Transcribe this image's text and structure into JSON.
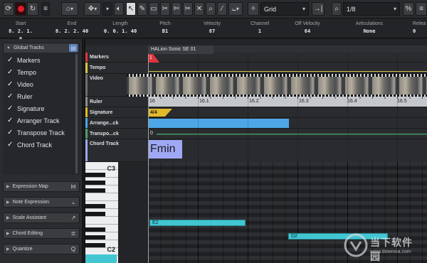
{
  "toolbar": {
    "grid_label": "Grid",
    "quantize_value": "1/8"
  },
  "info_line": [
    {
      "label": "Start",
      "value": "8. 2. 1.   0"
    },
    {
      "label": "End",
      "value": "8. 2. 2. 40"
    },
    {
      "label": "Length",
      "value": "0. 0. 1. 40"
    },
    {
      "label": "Pitch",
      "value": "B1"
    },
    {
      "label": "Velocity",
      "value": "87"
    },
    {
      "label": "Channel",
      "value": "1"
    },
    {
      "label": "Off Velocity",
      "value": "64"
    },
    {
      "label": "Articulations",
      "value": "None"
    },
    {
      "label": "Relea",
      "value": "0"
    }
  ],
  "inspector": {
    "global_tracks": {
      "title": "Global Tracks",
      "items": [
        "Markers",
        "Tempo",
        "Video",
        "Ruler",
        "Signature",
        "Arranger Track",
        "Transpose Track",
        "Chord Track"
      ]
    },
    "sections": [
      "Expression Map",
      "Note Expression",
      "Scale Assistant",
      "Chord Editing",
      "Quantize"
    ]
  },
  "editor": {
    "instrument_title": "HALion Sonic SE 01",
    "tracks": [
      "Markers",
      "Tempo",
      "Video",
      "Ruler",
      "Signature",
      "Arrange...ck",
      "Transpo...ck",
      "Chord Track"
    ],
    "marker_number": "1",
    "ruler_labels": [
      "16",
      "16.1",
      "16.2",
      "16.3",
      "16.4",
      "16.5"
    ],
    "signature": "4/4",
    "transpose_value": "0",
    "chord": "Fmin"
  },
  "piano": {
    "key_labels": [
      "C3",
      "C2"
    ],
    "notes": [
      {
        "label": "E2"
      },
      {
        "label": "D2"
      }
    ]
  },
  "watermark": {
    "text_cn": "当下软件园",
    "url": "www.downxia.com"
  },
  "colors": {
    "marker_red": "#e0343c",
    "tempo_yellow": "#d8c64a",
    "signature_gold": "#e2b92c",
    "arranger_blue": "#4ea6e6",
    "transpose_green": "#4ea06e",
    "chord_lavender": "#9fa8f4",
    "note_cyan": "#41c6d2"
  }
}
